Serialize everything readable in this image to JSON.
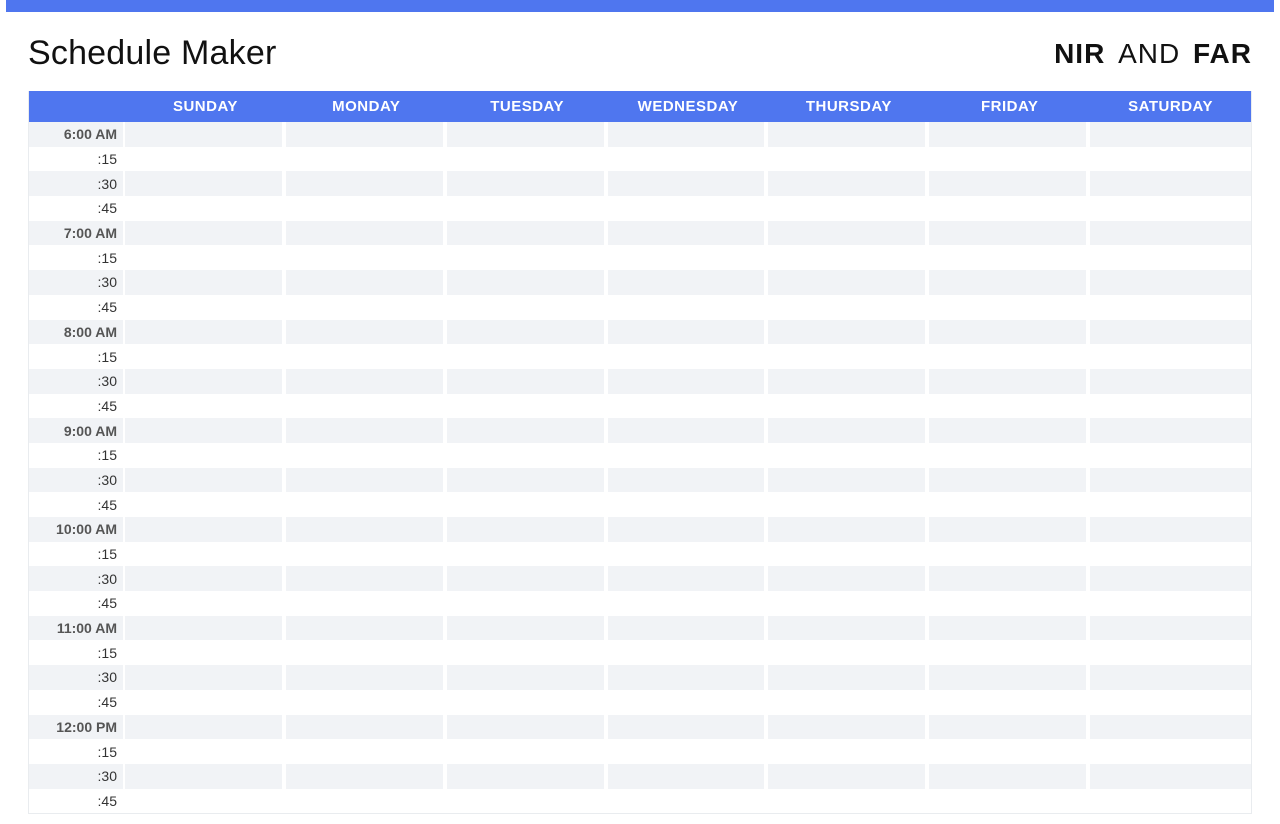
{
  "title": "Schedule Maker",
  "brand": {
    "part1": "NIR",
    "part2": "AND",
    "part3": "FAR"
  },
  "days": [
    "SUNDAY",
    "MONDAY",
    "TUESDAY",
    "WEDNESDAY",
    "THURSDAY",
    "FRIDAY",
    "SATURDAY"
  ],
  "rows": [
    {
      "label": "6:00 AM",
      "hour": true,
      "alt": true
    },
    {
      "label": ":15",
      "hour": false,
      "alt": false
    },
    {
      "label": ":30",
      "hour": false,
      "alt": true
    },
    {
      "label": ":45",
      "hour": false,
      "alt": false
    },
    {
      "label": "7:00 AM",
      "hour": true,
      "alt": true
    },
    {
      "label": ":15",
      "hour": false,
      "alt": false
    },
    {
      "label": ":30",
      "hour": false,
      "alt": true
    },
    {
      "label": ":45",
      "hour": false,
      "alt": false
    },
    {
      "label": "8:00 AM",
      "hour": true,
      "alt": true
    },
    {
      "label": ":15",
      "hour": false,
      "alt": false
    },
    {
      "label": ":30",
      "hour": false,
      "alt": true
    },
    {
      "label": ":45",
      "hour": false,
      "alt": false
    },
    {
      "label": "9:00 AM",
      "hour": true,
      "alt": true
    },
    {
      "label": ":15",
      "hour": false,
      "alt": false
    },
    {
      "label": ":30",
      "hour": false,
      "alt": true
    },
    {
      "label": ":45",
      "hour": false,
      "alt": false
    },
    {
      "label": "10:00 AM",
      "hour": true,
      "alt": true
    },
    {
      "label": ":15",
      "hour": false,
      "alt": false
    },
    {
      "label": ":30",
      "hour": false,
      "alt": true
    },
    {
      "label": ":45",
      "hour": false,
      "alt": false
    },
    {
      "label": "11:00 AM",
      "hour": true,
      "alt": true
    },
    {
      "label": ":15",
      "hour": false,
      "alt": false
    },
    {
      "label": ":30",
      "hour": false,
      "alt": true
    },
    {
      "label": ":45",
      "hour": false,
      "alt": false
    },
    {
      "label": "12:00 PM",
      "hour": true,
      "alt": true
    },
    {
      "label": ":15",
      "hour": false,
      "alt": false
    },
    {
      "label": ":30",
      "hour": false,
      "alt": true
    },
    {
      "label": ":45",
      "hour": false,
      "alt": false
    }
  ]
}
